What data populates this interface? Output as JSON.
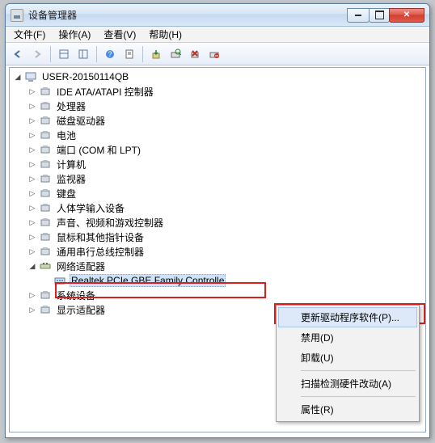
{
  "window": {
    "title": "设备管理器"
  },
  "menu": {
    "file": "文件(F)",
    "action": "操作(A)",
    "view": "查看(V)",
    "help": "帮助(H)"
  },
  "tree": {
    "root": "USER-20150114QB",
    "items": [
      "IDE ATA/ATAPI 控制器",
      "处理器",
      "磁盘驱动器",
      "电池",
      "端口 (COM 和 LPT)",
      "计算机",
      "监视器",
      "键盘",
      "人体学输入设备",
      "声音、视频和游戏控制器",
      "鼠标和其他指针设备",
      "通用串行总线控制器",
      "网络适配器",
      "系统设备",
      "显示适配器"
    ],
    "network_child": "Realtek PCIe GBE Family Controlle",
    "expanded_index": 12
  },
  "context": {
    "update": "更新驱动程序软件(P)...",
    "disable": "禁用(D)",
    "uninstall": "卸载(U)",
    "scan": "扫描检测硬件改动(A)",
    "properties": "属性(R)"
  }
}
